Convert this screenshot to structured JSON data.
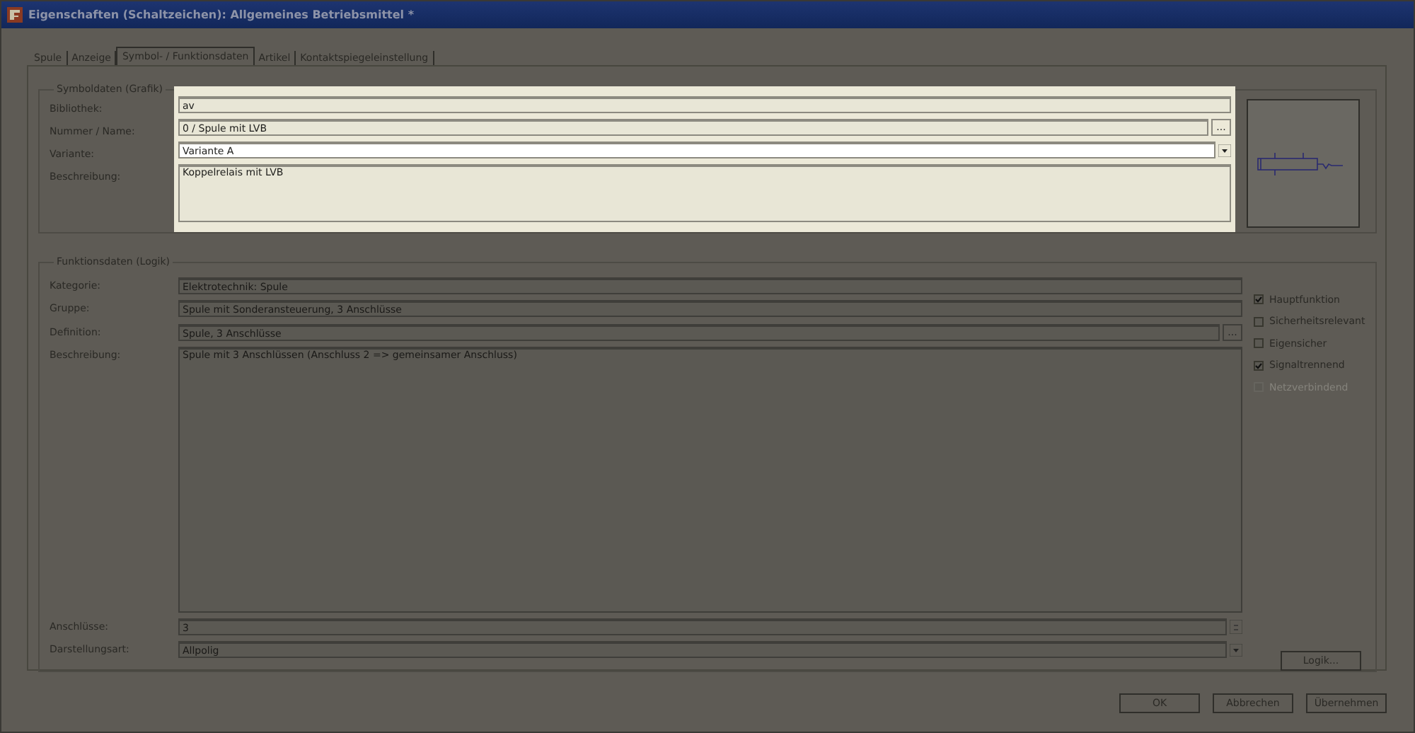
{
  "window": {
    "title": "Eigenschaften (Schaltzeichen): Allgemeines Betriebsmittel *"
  },
  "tabs": [
    {
      "label": "Spule",
      "selected": false
    },
    {
      "label": "Anzeige",
      "selected": false
    },
    {
      "label": "Symbol- / Funktionsdaten",
      "selected": true
    },
    {
      "label": "Artikel",
      "selected": false
    },
    {
      "label": "Kontaktspiegeleinstellung",
      "selected": false
    }
  ],
  "symbol_data": {
    "title": "Symboldaten (Grafik)",
    "highlighted": true,
    "fields": [
      {
        "label": "Bibliothek:",
        "value": "av",
        "kind": "text"
      },
      {
        "label": "Nummer / Name:",
        "value": "0 / Spule mit LVB",
        "kind": "browse",
        "button": "..."
      },
      {
        "label": "Variante:",
        "value": "Variante A",
        "kind": "combo"
      },
      {
        "label": "Beschreibung:",
        "value": "Koppelrelais mit LVB",
        "kind": "textarea"
      }
    ]
  },
  "function_data": {
    "title": "Funktionsdaten (Logik)",
    "fields": [
      {
        "label": "Kategorie:",
        "value": "Elektrotechnik: Spule",
        "kind": "text"
      },
      {
        "label": "Gruppe:",
        "value": "Spule mit Sonderansteuerung, 3 Anschlüsse",
        "kind": "text"
      },
      {
        "label": "Definition:",
        "value": "Spule, 3 Anschlüsse",
        "kind": "browse",
        "button": "..."
      },
      {
        "label": "Beschreibung:",
        "value": "Spule mit 3 Anschlüssen (Anschluss 2 => gemeinsamer Anschluss)",
        "kind": "textarea"
      },
      {
        "label": "Anschlüsse:",
        "value": "3",
        "kind": "spin"
      },
      {
        "label": "Darstellungsart:",
        "value": "Allpolig",
        "kind": "combo"
      }
    ],
    "checkboxes": [
      {
        "label": "Hauptfunktion",
        "checked": true,
        "disabled": false
      },
      {
        "label": "Sicherheitsrelevant",
        "checked": false,
        "disabled": false
      },
      {
        "label": "Eigensicher",
        "checked": false,
        "disabled": false
      },
      {
        "label": "Signaltrennend",
        "checked": true,
        "disabled": false
      },
      {
        "label": "Netzverbindend",
        "checked": false,
        "disabled": true
      }
    ],
    "logic_button": "Logik..."
  },
  "buttons": [
    "OK",
    "Abbrechen",
    "Übernehmen"
  ]
}
